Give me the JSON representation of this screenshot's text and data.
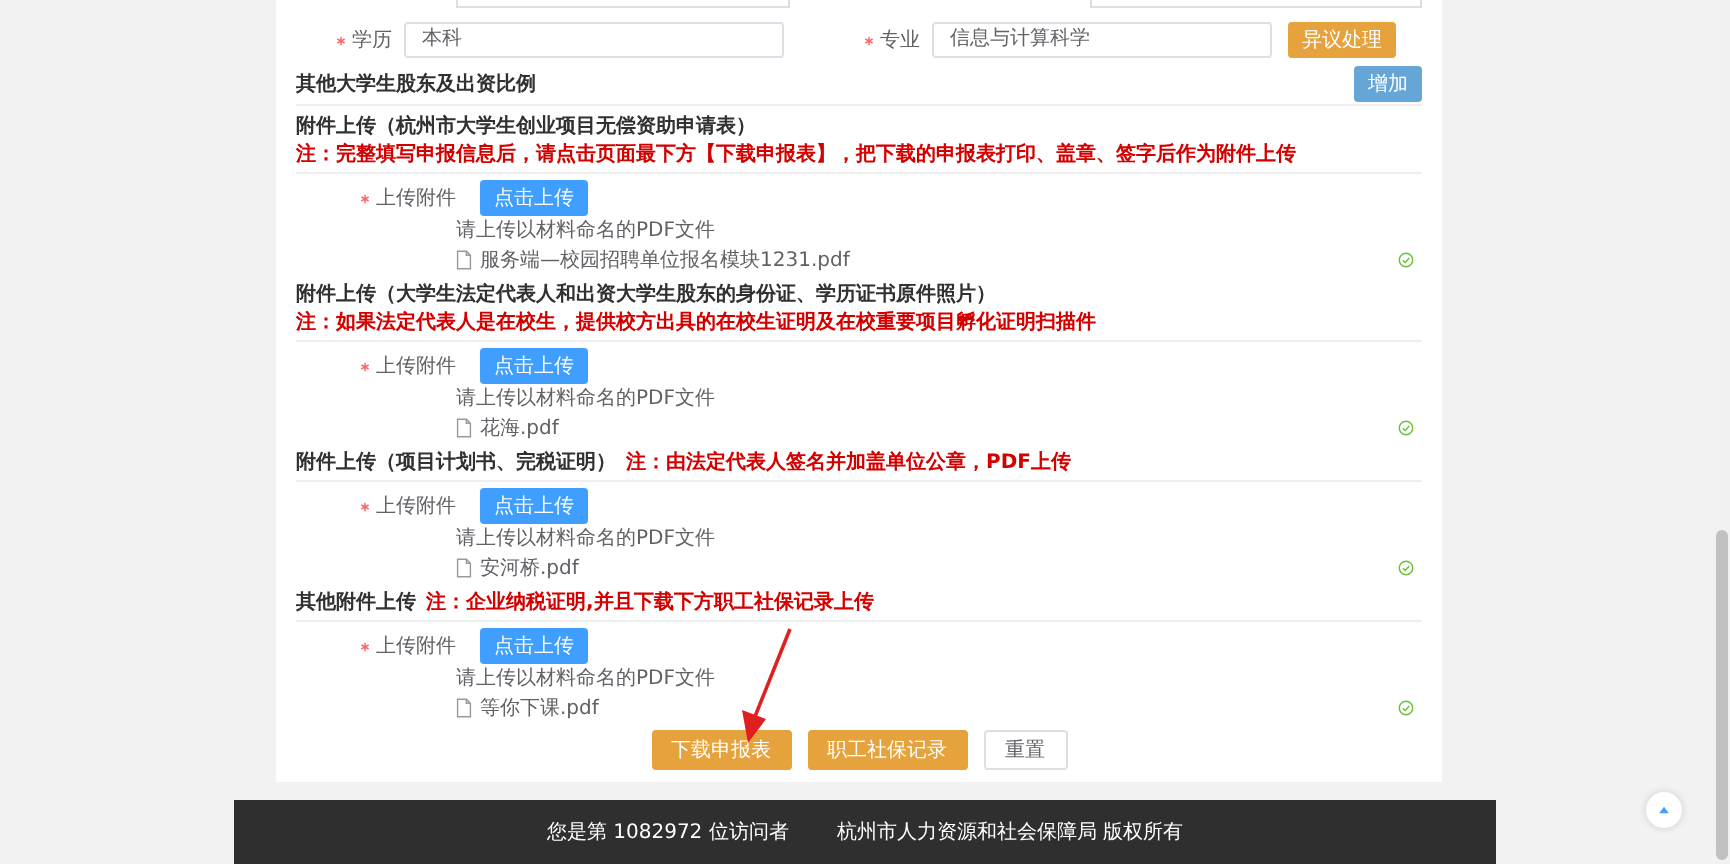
{
  "form_row": {
    "fields": [
      {
        "label": "学历",
        "required": true,
        "value": "本科"
      },
      {
        "label": "专业",
        "required": true,
        "value": "信息与计算科学"
      }
    ],
    "button": "异议处理"
  },
  "shareholders": {
    "title": "其他大学生股东及出资比例",
    "button": "增加"
  },
  "attachments": [
    {
      "title": "附件上传（杭州市大学生创业项目无偿资助申请表）",
      "note": "注：完整填写申报信息后，请点击页面最下方【下载申报表】，把下载的申报表打印、盖章、签字后作为附件上传",
      "label": "上传附件",
      "required": true,
      "button": "点击上传",
      "hint": "请上传以材料命名的PDF文件",
      "file": "服务端—校园招聘单位报名模块1231.pdf",
      "uploaded": true
    },
    {
      "title": "附件上传（大学生法定代表人和出资大学生股东的身份证、学历证书原件照片）",
      "note": "注：如果法定代表人是在校生，提供校方出具的在校生证明及在校重要项目孵化证明扫描件",
      "label": "上传附件",
      "required": true,
      "button": "点击上传",
      "hint": "请上传以材料命名的PDF文件",
      "file": "花海.pdf",
      "uploaded": true
    },
    {
      "title": "附件上传（项目计划书、完税证明）",
      "note": "注：由法定代表人签名并加盖单位公章，PDF上传",
      "label": "上传附件",
      "required": true,
      "button": "点击上传",
      "hint": "请上传以材料命名的PDF文件",
      "file": "安河桥.pdf",
      "uploaded": true
    },
    {
      "title": "其他附件上传",
      "note": "注：企业纳税证明,并且下载下方职工社保记录上传",
      "label": "上传附件",
      "required": true,
      "button": "点击上传",
      "hint": "请上传以材料命名的PDF文件",
      "file": "等你下课.pdf",
      "uploaded": true
    }
  ],
  "actions": [
    {
      "label": "下载申报表",
      "kind": "primary"
    },
    {
      "label": "职工社保记录",
      "kind": "primary"
    },
    {
      "label": "重置",
      "kind": "plain"
    }
  ],
  "footer": {
    "visitors": "您是第 1082972 位访问者",
    "copyright": "杭州市人力资源和社会保障局 版权所有"
  }
}
